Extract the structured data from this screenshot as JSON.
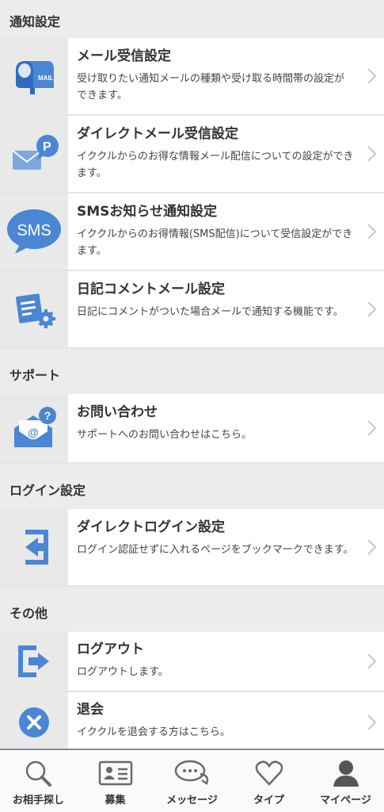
{
  "sections": {
    "notification": {
      "header": "通知設定",
      "items": [
        {
          "title": "メール受信設定",
          "desc": "受け取りたい通知メールの種類や受け取る時間帯の設定ができます。",
          "icon": "mailbox-icon"
        },
        {
          "title": "ダイレクトメール受信設定",
          "desc": "イククルからのお得な情報メール配信についての設定ができます。",
          "icon": "points-mail-icon"
        },
        {
          "title": "SMSお知らせ通知設定",
          "desc": "イククルからのお得情報(SMS配信)について受信設定ができます。",
          "icon": "sms-bubble-icon",
          "icon_text": "SMS"
        },
        {
          "title": "日記コメントメール設定",
          "desc": "日記にコメントがついた場合メールで通知する機能です。",
          "icon": "diary-settings-icon"
        }
      ]
    },
    "support": {
      "header": "サポート",
      "items": [
        {
          "title": "お問い合わせ",
          "desc": "サポートへのお問い合わせはこちら。",
          "icon": "inquiry-mail-icon"
        }
      ]
    },
    "login": {
      "header": "ログイン設定",
      "items": [
        {
          "title": "ダイレクトログイン設定",
          "desc": "ログイン認証せずに入れるページをブックマークできます。",
          "icon": "login-icon"
        }
      ]
    },
    "other": {
      "header": "その他",
      "items": [
        {
          "title": "ログアウト",
          "desc": "ログアウトします。",
          "icon": "logout-icon"
        },
        {
          "title": "退会",
          "desc": "イククルを退会する方はこちら。",
          "icon": "withdraw-icon"
        }
      ]
    }
  },
  "tabbar": [
    {
      "label": "お相手探し",
      "icon": "search-icon"
    },
    {
      "label": "募集",
      "icon": "profile-card-icon"
    },
    {
      "label": "メッセージ",
      "icon": "message-icon"
    },
    {
      "label": "タイプ",
      "icon": "heart-icon"
    },
    {
      "label": "マイページ",
      "icon": "person-icon"
    }
  ],
  "colors": {
    "accent": "#4a86d4",
    "icon_bg": "#e9e9e9",
    "page_bg": "#ececec"
  }
}
